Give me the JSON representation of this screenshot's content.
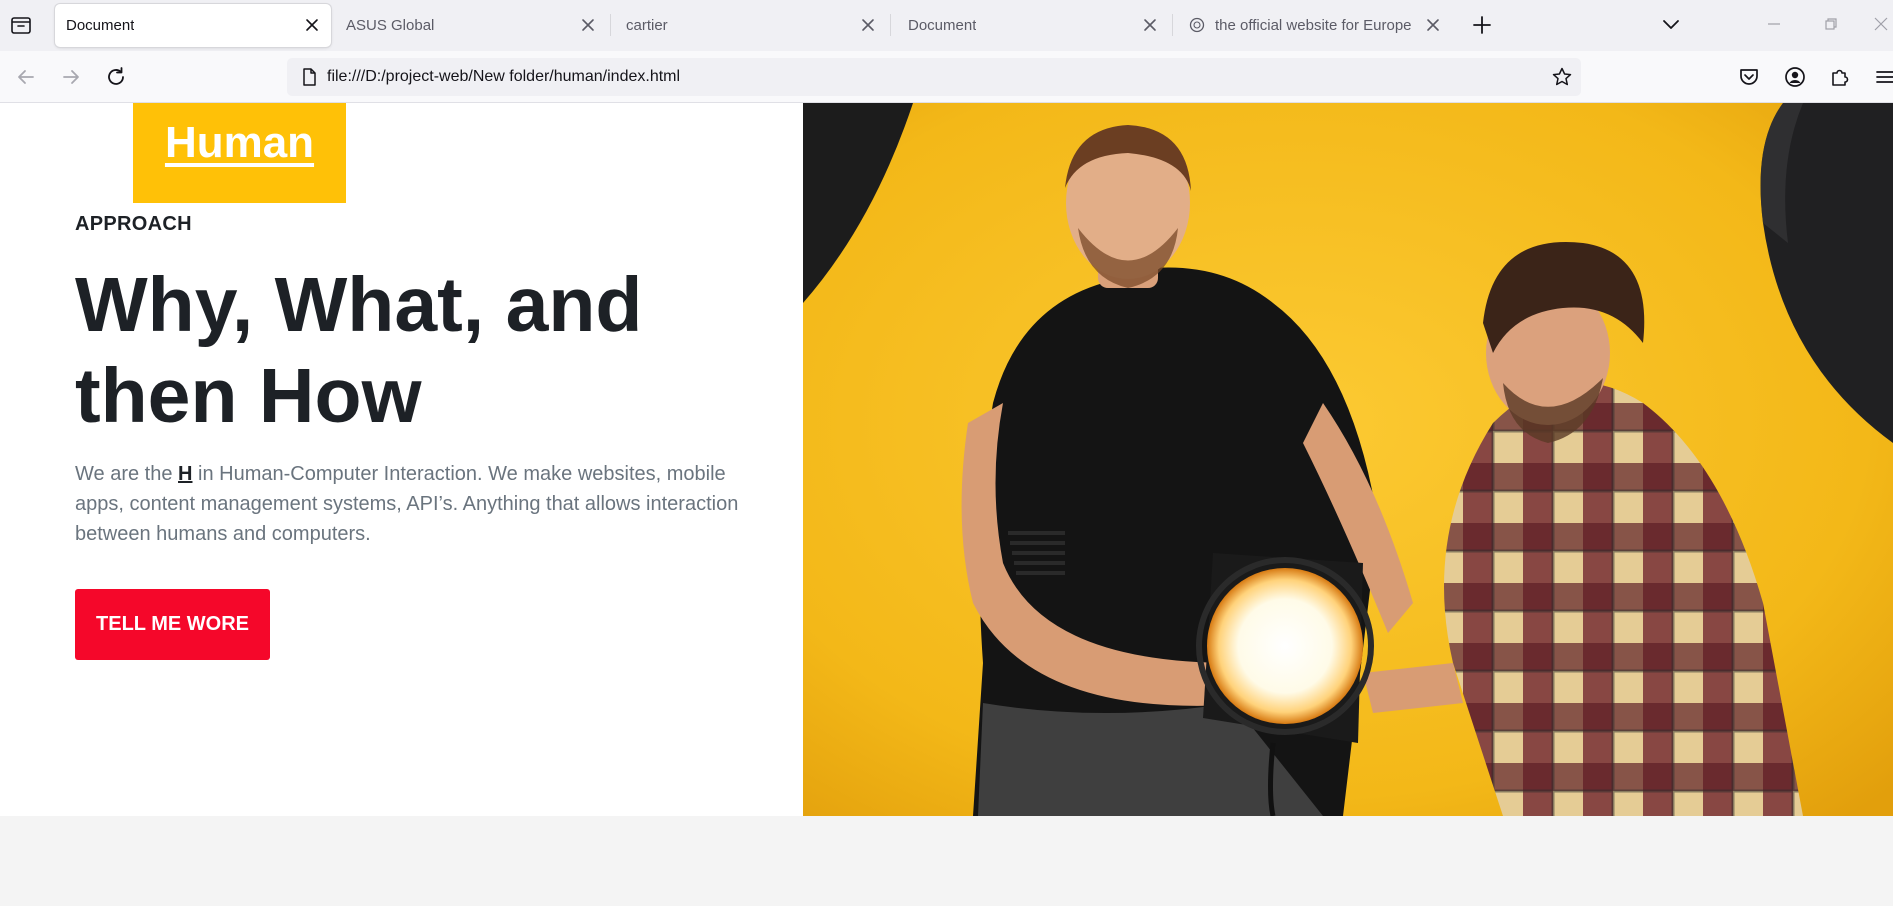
{
  "browser": {
    "tabs": [
      {
        "title": "Document",
        "active": true
      },
      {
        "title": "ASUS Global",
        "active": false
      },
      {
        "title": "cartier",
        "active": false
      },
      {
        "title": "Document",
        "active": false
      },
      {
        "title": "the official website for Europe",
        "active": false
      }
    ],
    "url": "file:///D:/project-web/New folder/human/index.html"
  },
  "page": {
    "logo": "Human",
    "eyebrow": "APPROACH",
    "headline_line1": "Why, What, and",
    "headline_line2": "then How",
    "description_prefix": "We are the ",
    "description_mark": "H",
    "description_suffix": " in Human-Computer Interaction. We make websites, mobile apps, content management systems, API’s. Anything that allows interaction between humans and computers.",
    "cta_label": "TELL ME WORE"
  },
  "colors": {
    "logo_bg": "#ffc107",
    "cta_bg": "#f5072a",
    "heading": "#1d2126",
    "body_text": "#6a747e",
    "photo_backdrop": "#f3b818"
  },
  "icons": {
    "tab_list": "tab-list-icon",
    "close": "close-icon",
    "new_tab": "plus-icon",
    "back": "arrow-left-icon",
    "forward": "arrow-right-icon",
    "reload": "reload-icon",
    "file": "file-icon",
    "bookmark": "star-icon",
    "pocket": "pocket-icon",
    "account": "account-icon",
    "extensions": "puzzle-icon",
    "menu": "hamburger-icon"
  }
}
